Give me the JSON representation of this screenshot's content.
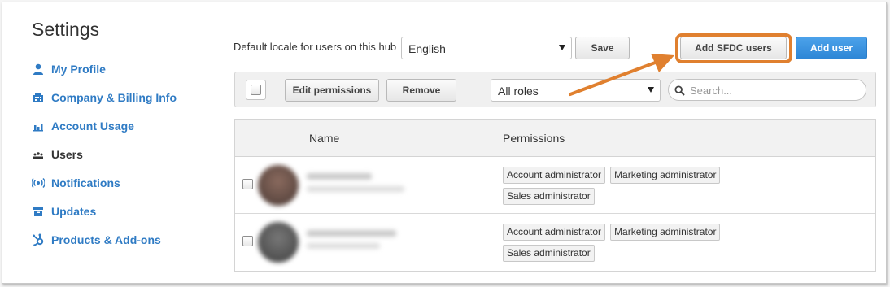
{
  "page": {
    "title": "Settings"
  },
  "colors": {
    "accent": "#2f7bc4",
    "primary_button": "#3a94e0",
    "highlight": "#e0802f"
  },
  "sidebar": {
    "items": [
      {
        "label": "My Profile",
        "icon": "user-icon",
        "active": false
      },
      {
        "label": "Company & Billing Info",
        "icon": "building-icon",
        "active": false
      },
      {
        "label": "Account Usage",
        "icon": "bar-chart-icon",
        "active": false
      },
      {
        "label": "Users",
        "icon": "users-icon",
        "active": true
      },
      {
        "label": "Notifications",
        "icon": "broadcast-icon",
        "active": false
      },
      {
        "label": "Updates",
        "icon": "archive-icon",
        "active": false
      },
      {
        "label": "Products & Add-ons",
        "icon": "hubspot-sprocket-icon",
        "active": false
      }
    ]
  },
  "locale": {
    "label": "Default locale for users on this hub",
    "value": "English",
    "save_label": "Save"
  },
  "header_actions": {
    "add_sfdc_label": "Add SFDC users",
    "add_user_label": "Add user"
  },
  "toolbar": {
    "edit_permissions_label": "Edit permissions",
    "remove_label": "Remove",
    "roles_value": "All roles",
    "search_placeholder": "Search..."
  },
  "table": {
    "columns": [
      "Name",
      "Permissions"
    ],
    "rows": [
      {
        "permissions": [
          "Account administrator",
          "Marketing administrator",
          "Sales administrator"
        ]
      },
      {
        "permissions": [
          "Account administrator",
          "Marketing administrator",
          "Sales administrator"
        ]
      }
    ]
  }
}
